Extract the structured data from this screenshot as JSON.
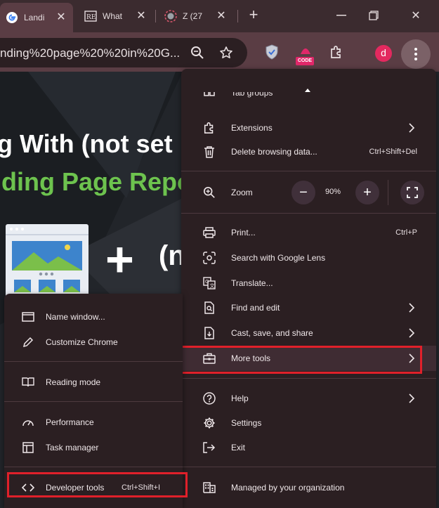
{
  "tabs": [
    {
      "title": "Landi"
    },
    {
      "title": "What"
    },
    {
      "title": "Z (27"
    }
  ],
  "toolbar": {
    "url": "nding%20page%20%20in%20G...",
    "ext_badge": "CODE",
    "avatar_letter": "d"
  },
  "page": {
    "line1": "g With (not set",
    "line2": "ding Page Repo",
    "line3": "(n"
  },
  "menu": {
    "partial_item": "Tab groups",
    "extensions": "Extensions",
    "delete_data": {
      "label": "Delete browsing data...",
      "shortcut": "Ctrl+Shift+Del"
    },
    "zoom": {
      "label": "Zoom",
      "value": "90%",
      "minus": "−",
      "plus": "+"
    },
    "print": {
      "label": "Print...",
      "shortcut": "Ctrl+P"
    },
    "lens": "Search with Google Lens",
    "translate": "Translate...",
    "find_edit": "Find and edit",
    "cast_save": "Cast, save, and share",
    "more_tools": "More tools",
    "help": "Help",
    "settings": "Settings",
    "exit": "Exit",
    "managed": "Managed by your organization"
  },
  "submenu": {
    "name_window": "Name window...",
    "customize": "Customize Chrome",
    "reading_mode": "Reading mode",
    "performance": "Performance",
    "task_manager": "Task manager",
    "dev_tools": {
      "label": "Developer tools",
      "shortcut": "Ctrl+Shift+I"
    }
  },
  "colors": {
    "menu_bg": "#2b1f22",
    "highlight": "#e0202a",
    "accent_pink": "#e3295f"
  }
}
